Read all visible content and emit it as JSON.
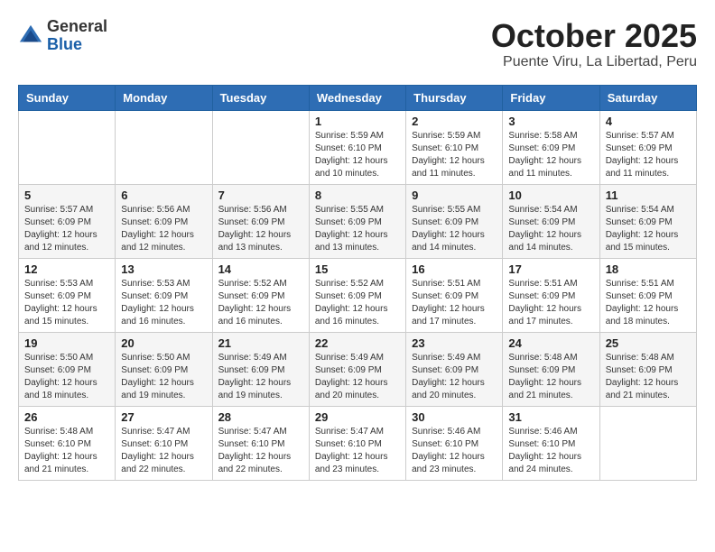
{
  "logo": {
    "general": "General",
    "blue": "Blue"
  },
  "header": {
    "month": "October 2025",
    "location": "Puente Viru, La Libertad, Peru"
  },
  "weekdays": [
    "Sunday",
    "Monday",
    "Tuesday",
    "Wednesday",
    "Thursday",
    "Friday",
    "Saturday"
  ],
  "weeks": [
    [
      {
        "day": "",
        "info": ""
      },
      {
        "day": "",
        "info": ""
      },
      {
        "day": "",
        "info": ""
      },
      {
        "day": "1",
        "info": "Sunrise: 5:59 AM\nSunset: 6:10 PM\nDaylight: 12 hours\nand 10 minutes."
      },
      {
        "day": "2",
        "info": "Sunrise: 5:59 AM\nSunset: 6:10 PM\nDaylight: 12 hours\nand 11 minutes."
      },
      {
        "day": "3",
        "info": "Sunrise: 5:58 AM\nSunset: 6:09 PM\nDaylight: 12 hours\nand 11 minutes."
      },
      {
        "day": "4",
        "info": "Sunrise: 5:57 AM\nSunset: 6:09 PM\nDaylight: 12 hours\nand 11 minutes."
      }
    ],
    [
      {
        "day": "5",
        "info": "Sunrise: 5:57 AM\nSunset: 6:09 PM\nDaylight: 12 hours\nand 12 minutes."
      },
      {
        "day": "6",
        "info": "Sunrise: 5:56 AM\nSunset: 6:09 PM\nDaylight: 12 hours\nand 12 minutes."
      },
      {
        "day": "7",
        "info": "Sunrise: 5:56 AM\nSunset: 6:09 PM\nDaylight: 12 hours\nand 13 minutes."
      },
      {
        "day": "8",
        "info": "Sunrise: 5:55 AM\nSunset: 6:09 PM\nDaylight: 12 hours\nand 13 minutes."
      },
      {
        "day": "9",
        "info": "Sunrise: 5:55 AM\nSunset: 6:09 PM\nDaylight: 12 hours\nand 14 minutes."
      },
      {
        "day": "10",
        "info": "Sunrise: 5:54 AM\nSunset: 6:09 PM\nDaylight: 12 hours\nand 14 minutes."
      },
      {
        "day": "11",
        "info": "Sunrise: 5:54 AM\nSunset: 6:09 PM\nDaylight: 12 hours\nand 15 minutes."
      }
    ],
    [
      {
        "day": "12",
        "info": "Sunrise: 5:53 AM\nSunset: 6:09 PM\nDaylight: 12 hours\nand 15 minutes."
      },
      {
        "day": "13",
        "info": "Sunrise: 5:53 AM\nSunset: 6:09 PM\nDaylight: 12 hours\nand 16 minutes."
      },
      {
        "day": "14",
        "info": "Sunrise: 5:52 AM\nSunset: 6:09 PM\nDaylight: 12 hours\nand 16 minutes."
      },
      {
        "day": "15",
        "info": "Sunrise: 5:52 AM\nSunset: 6:09 PM\nDaylight: 12 hours\nand 16 minutes."
      },
      {
        "day": "16",
        "info": "Sunrise: 5:51 AM\nSunset: 6:09 PM\nDaylight: 12 hours\nand 17 minutes."
      },
      {
        "day": "17",
        "info": "Sunrise: 5:51 AM\nSunset: 6:09 PM\nDaylight: 12 hours\nand 17 minutes."
      },
      {
        "day": "18",
        "info": "Sunrise: 5:51 AM\nSunset: 6:09 PM\nDaylight: 12 hours\nand 18 minutes."
      }
    ],
    [
      {
        "day": "19",
        "info": "Sunrise: 5:50 AM\nSunset: 6:09 PM\nDaylight: 12 hours\nand 18 minutes."
      },
      {
        "day": "20",
        "info": "Sunrise: 5:50 AM\nSunset: 6:09 PM\nDaylight: 12 hours\nand 19 minutes."
      },
      {
        "day": "21",
        "info": "Sunrise: 5:49 AM\nSunset: 6:09 PM\nDaylight: 12 hours\nand 19 minutes."
      },
      {
        "day": "22",
        "info": "Sunrise: 5:49 AM\nSunset: 6:09 PM\nDaylight: 12 hours\nand 20 minutes."
      },
      {
        "day": "23",
        "info": "Sunrise: 5:49 AM\nSunset: 6:09 PM\nDaylight: 12 hours\nand 20 minutes."
      },
      {
        "day": "24",
        "info": "Sunrise: 5:48 AM\nSunset: 6:09 PM\nDaylight: 12 hours\nand 21 minutes."
      },
      {
        "day": "25",
        "info": "Sunrise: 5:48 AM\nSunset: 6:09 PM\nDaylight: 12 hours\nand 21 minutes."
      }
    ],
    [
      {
        "day": "26",
        "info": "Sunrise: 5:48 AM\nSunset: 6:10 PM\nDaylight: 12 hours\nand 21 minutes."
      },
      {
        "day": "27",
        "info": "Sunrise: 5:47 AM\nSunset: 6:10 PM\nDaylight: 12 hours\nand 22 minutes."
      },
      {
        "day": "28",
        "info": "Sunrise: 5:47 AM\nSunset: 6:10 PM\nDaylight: 12 hours\nand 22 minutes."
      },
      {
        "day": "29",
        "info": "Sunrise: 5:47 AM\nSunset: 6:10 PM\nDaylight: 12 hours\nand 23 minutes."
      },
      {
        "day": "30",
        "info": "Sunrise: 5:46 AM\nSunset: 6:10 PM\nDaylight: 12 hours\nand 23 minutes."
      },
      {
        "day": "31",
        "info": "Sunrise: 5:46 AM\nSunset: 6:10 PM\nDaylight: 12 hours\nand 24 minutes."
      },
      {
        "day": "",
        "info": ""
      }
    ]
  ]
}
